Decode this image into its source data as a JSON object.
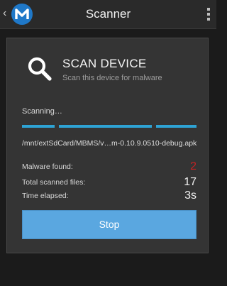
{
  "app_bar": {
    "back_glyph": "‹",
    "title": "Scanner",
    "logo_icon": "malwarebytes-logo-icon",
    "menu_icon": "overflow-menu-icon"
  },
  "scan": {
    "heading": "SCAN DEVICE",
    "subheading": "Scan this device for malware",
    "icon": "magnifier-icon",
    "status": "Scanning…",
    "current_file": "/mnt/extSdCard/MBMS/v…m-0.10.9.0510-debug.apk"
  },
  "stats": [
    {
      "label": "Malware found:",
      "value": "2"
    },
    {
      "label": "Total scanned files:",
      "value": "17"
    },
    {
      "label": "Time elapsed:",
      "value": "3s"
    }
  ],
  "actions": {
    "stop_label": "Stop"
  },
  "colors": {
    "accent": "#2ea3d4",
    "button": "#5aa7e0",
    "danger": "#c12323",
    "card": "#343434",
    "background": "#1b1b1b"
  }
}
